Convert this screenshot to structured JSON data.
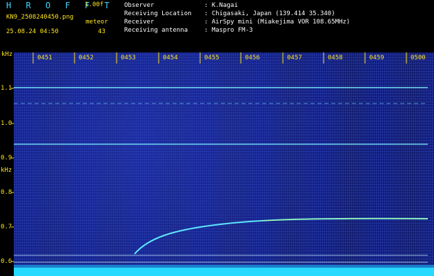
{
  "header": {
    "app_title": "H R O F F T",
    "version": "1.00f",
    "file_name": "KN9_2508240450.png",
    "obs_kind": "meteor",
    "date_time": "25.08.24 04:50",
    "count": "43"
  },
  "info": [
    {
      "label": "Observer",
      "value": ": K.Nagai"
    },
    {
      "label": "Receiving Location",
      "value": ": Chigasaki, Japan (139.414 35.340)"
    },
    {
      "label": "Receiver",
      "value": ": AirSpy mini (Miakejima VOR 108.65MHz)"
    },
    {
      "label": "Receiving antenna",
      "value": ": Maspro FM-3"
    }
  ],
  "axis": {
    "unit_top": "kHz",
    "unit_mid": "kHz",
    "y_ticks": [
      "1.1",
      "1.0",
      "0.9",
      "0.8",
      "0.7",
      "0.6"
    ],
    "x_ticks": [
      "0451",
      "0452",
      "0453",
      "0454",
      "0455",
      "0456",
      "0457",
      "0458",
      "0459",
      "0500"
    ]
  },
  "colors": {
    "label_yellow": "#ffe51c",
    "title_cyan": "#41d7ff",
    "background_blue": "#14207a",
    "signal_cyan": "#5fe8ff"
  }
}
